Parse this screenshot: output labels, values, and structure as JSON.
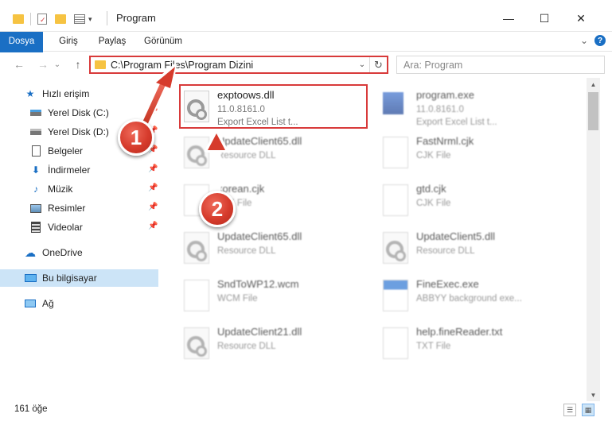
{
  "window": {
    "title": "Program",
    "minimize_glyph": "—",
    "maximize_glyph": "☐",
    "close_glyph": "✕"
  },
  "ribbon": {
    "tabs": [
      "Dosya",
      "Giriş",
      "Paylaş",
      "Görünüm"
    ],
    "expand_glyph": "⌄",
    "help_glyph": "?"
  },
  "nav": {
    "back_glyph": "←",
    "forward_glyph": "→",
    "recent_glyph": "⌄",
    "up_glyph": "↑",
    "address": "C:\\Program Files\\Program Dizini",
    "search_placeholder": "Ara: Program"
  },
  "sidebar": {
    "items": [
      {
        "label": "Hızlı erişim",
        "icon": "star-icon"
      },
      {
        "label": "Yerel Disk (C:)",
        "icon": "drive-icon"
      },
      {
        "label": "Yerel Disk (D:)",
        "icon": "drive-icon"
      },
      {
        "label": "Belgeler",
        "icon": "documents-icon"
      },
      {
        "label": "İndirmeler",
        "icon": "download-icon"
      },
      {
        "label": "Müzik",
        "icon": "music-icon"
      },
      {
        "label": "Resimler",
        "icon": "pictures-icon"
      },
      {
        "label": "Videolar",
        "icon": "video-icon"
      },
      {
        "label": "OneDrive",
        "icon": "cloud-icon"
      },
      {
        "label": "Bu bilgisayar",
        "icon": "computer-icon"
      },
      {
        "label": "Ağ",
        "icon": "network-icon"
      }
    ]
  },
  "files": [
    {
      "name": "exptoows.dll",
      "line2": "11.0.8161.0",
      "line3": "Export Excel List t..."
    },
    {
      "name": "program.exe",
      "line2": "11.0.8161.0",
      "line3": "Export Excel List t..."
    },
    {
      "name": "UpdateClient65.dll",
      "line2": "Resource DLL"
    },
    {
      "name": "FastNrml.cjk",
      "line2": "CJK File"
    },
    {
      "name": "korean.cjk",
      "line2": "CJK File"
    },
    {
      "name": "gtd.cjk",
      "line2": "CJK File"
    },
    {
      "name": "UpdateClient65.dll",
      "line2": "Resource DLL"
    },
    {
      "name": "UpdateClient5.dll",
      "line2": "Resource DLL"
    },
    {
      "name": "SndToWP12.wcm",
      "line2": "WCM File"
    },
    {
      "name": "FineExec.exe",
      "line2": "ABBYY background exe..."
    },
    {
      "name": "UpdateClient21.dll",
      "line2": "Resource DLL"
    },
    {
      "name": "help.fineReader.txt",
      "line2": "TXT File"
    }
  ],
  "status": {
    "count": "161 öğe"
  },
  "markers": {
    "one": "1",
    "two": "2"
  },
  "colors": {
    "accent": "#1a6fc4",
    "highlight": "#d83a3a",
    "selected": "#cce4f7",
    "folder": "#f6c342"
  }
}
